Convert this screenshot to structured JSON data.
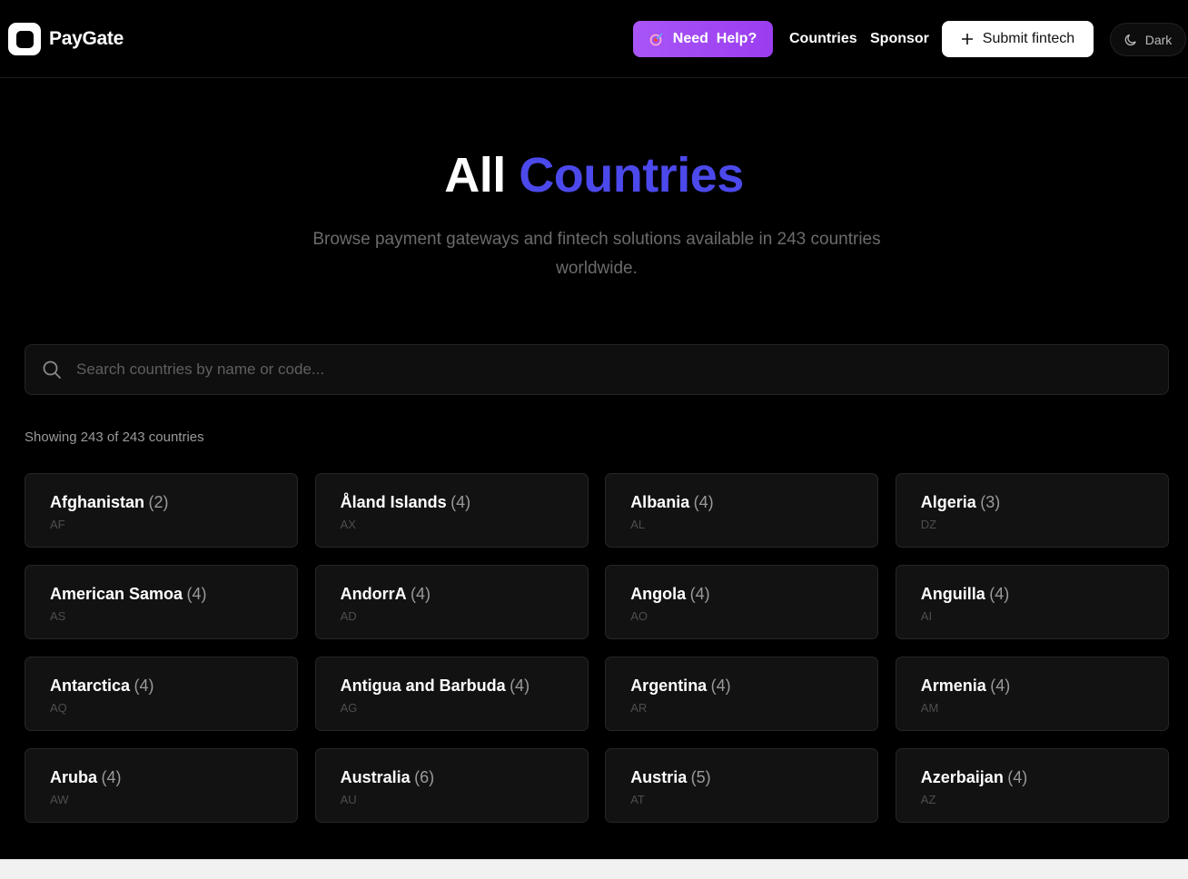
{
  "header": {
    "brand": "PayGate",
    "help_label": "Need  Help?",
    "nav": [
      "Countries",
      "Sponsor"
    ],
    "submit_label": "Submit fintech",
    "theme_label": "Dark",
    "help_gradient": [
      "#a855f7",
      "#9b3df0"
    ]
  },
  "hero": {
    "title_plain": "All",
    "title_accent": "Countries",
    "accent_color": "#4c49ec",
    "subtitle": "Browse payment gateways and fintech solutions available in 243 countries worldwide."
  },
  "search": {
    "placeholder": "Search countries by name or code..."
  },
  "results": {
    "summary": "Showing 243 of 243 countries"
  },
  "countries": [
    {
      "name": "Afghanistan",
      "count": "(2)",
      "code": "AF"
    },
    {
      "name": "Åland Islands",
      "count": "(4)",
      "code": "AX"
    },
    {
      "name": "Albania",
      "count": "(4)",
      "code": "AL"
    },
    {
      "name": "Algeria",
      "count": "(3)",
      "code": "DZ"
    },
    {
      "name": "American Samoa",
      "count": "(4)",
      "code": "AS"
    },
    {
      "name": "AndorrA",
      "count": "(4)",
      "code": "AD"
    },
    {
      "name": "Angola",
      "count": "(4)",
      "code": "AO"
    },
    {
      "name": "Anguilla",
      "count": "(4)",
      "code": "AI"
    },
    {
      "name": "Antarctica",
      "count": "(4)",
      "code": "AQ"
    },
    {
      "name": "Antigua and Barbuda",
      "count": "(4)",
      "code": "AG"
    },
    {
      "name": "Argentina",
      "count": "(4)",
      "code": "AR"
    },
    {
      "name": "Armenia",
      "count": "(4)",
      "code": "AM"
    },
    {
      "name": "Aruba",
      "count": "(4)",
      "code": "AW"
    },
    {
      "name": "Australia",
      "count": "(6)",
      "code": "AU"
    },
    {
      "name": "Austria",
      "count": "(5)",
      "code": "AT"
    },
    {
      "name": "Azerbaijan",
      "count": "(4)",
      "code": "AZ"
    }
  ]
}
